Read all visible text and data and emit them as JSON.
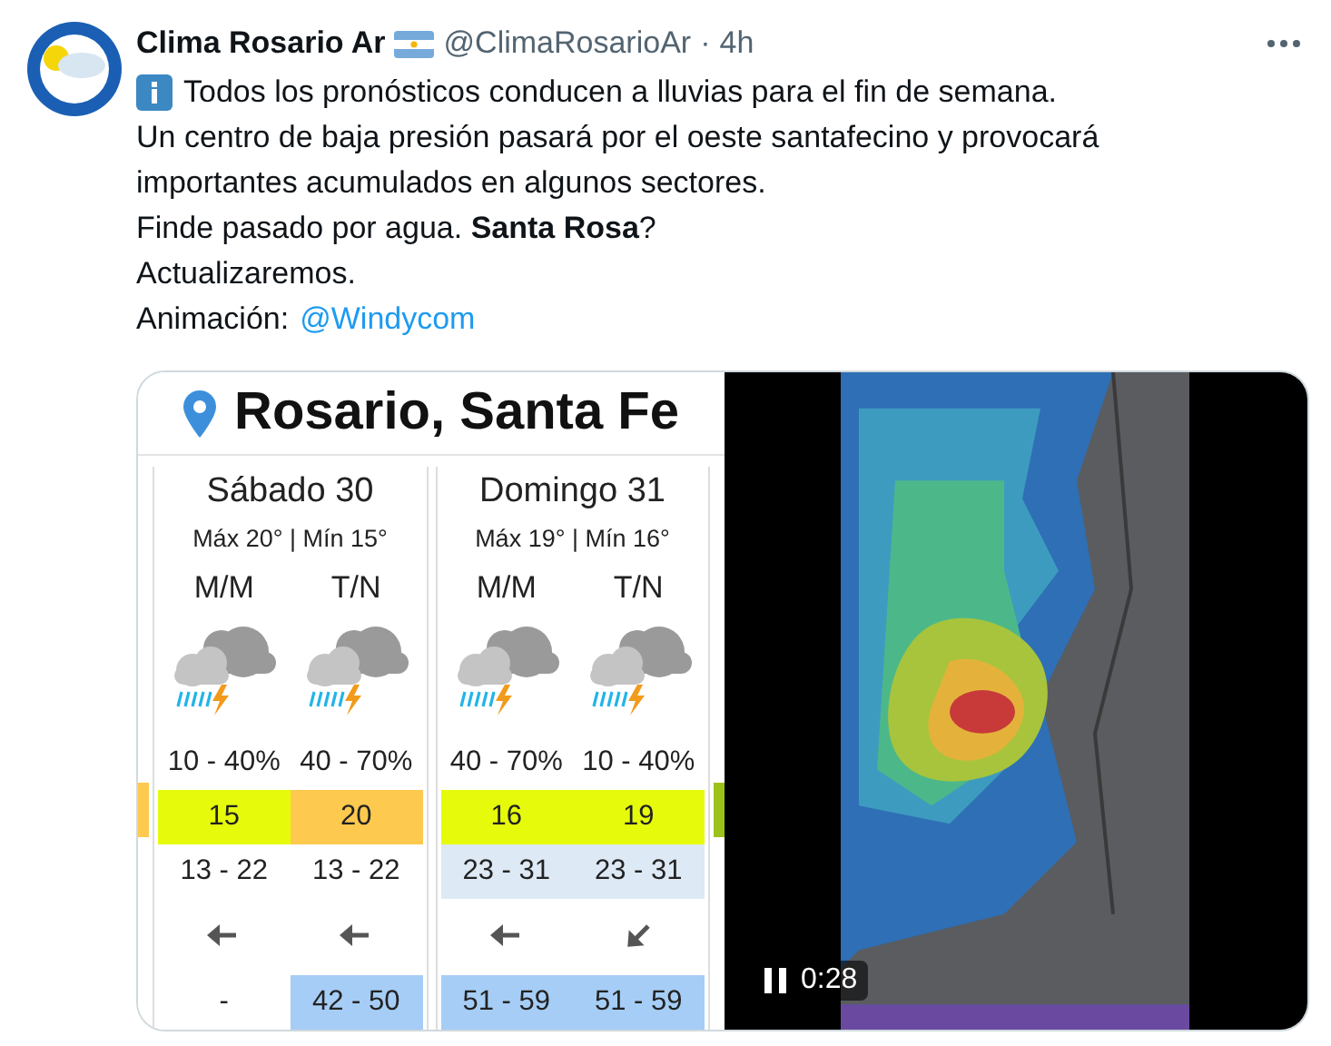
{
  "post": {
    "author": "Clima Rosario Ar",
    "handle": "@ClimaRosarioAr",
    "separator": "·",
    "time": "4h",
    "lines": [
      "Todos los pronósticos conducen a lluvias para el fin de semana.",
      "Un centro de baja presión pasará por el oeste santafecino y provocará",
      "importantes acumulados en algunos sectores.",
      "Finde pasado por agua. **Santa Rosa**?",
      "Actualizaremos."
    ],
    "last_line": {
      "text": "Animación:",
      "link": "@Windycom"
    }
  },
  "forecast": {
    "title": "Rosario, Santa Fe",
    "edges": [
      {
        "color": "#fdc94e"
      },
      {
        "color": "#9cc21a"
      }
    ],
    "days": [
      {
        "name": "Sábado 30",
        "maxmin": "Máx 20° | Mín 15°",
        "periods": [
          {
            "label": "M/M",
            "chance": "10 - 40%",
            "index": "15",
            "color": "#e6fb0c",
            "range": "13 - 22",
            "range_highlighted": false,
            "wind": {
              "kind": "west"
            },
            "gust": "-",
            "gust_highlighted": false
          },
          {
            "label": "T/N",
            "chance": "40 - 70%",
            "index": "20",
            "color": "#fdc94e",
            "range": "13 - 22",
            "range_highlighted": false,
            "wind": {
              "kind": "west"
            },
            "gust": "42 - 50",
            "gust_highlighted": true
          }
        ]
      },
      {
        "name": "Domingo 31",
        "maxmin": "Máx 19° | Mín 16°",
        "periods": [
          {
            "label": "M/M",
            "chance": "40 - 70%",
            "index": "16",
            "color": "#e6fb0c",
            "range": "23 - 31",
            "range_highlighted": true,
            "wind": {
              "kind": "west"
            },
            "gust": "51 - 59",
            "gust_highlighted": true
          },
          {
            "label": "T/N",
            "chance": "10 - 40%",
            "index": "19",
            "color": "#e6fb0c",
            "range": "23 - 31",
            "range_highlighted": true,
            "wind": {
              "kind": "southwest"
            },
            "gust": "51 - 59",
            "gust_highlighted": true
          }
        ]
      }
    ]
  },
  "video": {
    "time": "0:28",
    "playing": true
  }
}
